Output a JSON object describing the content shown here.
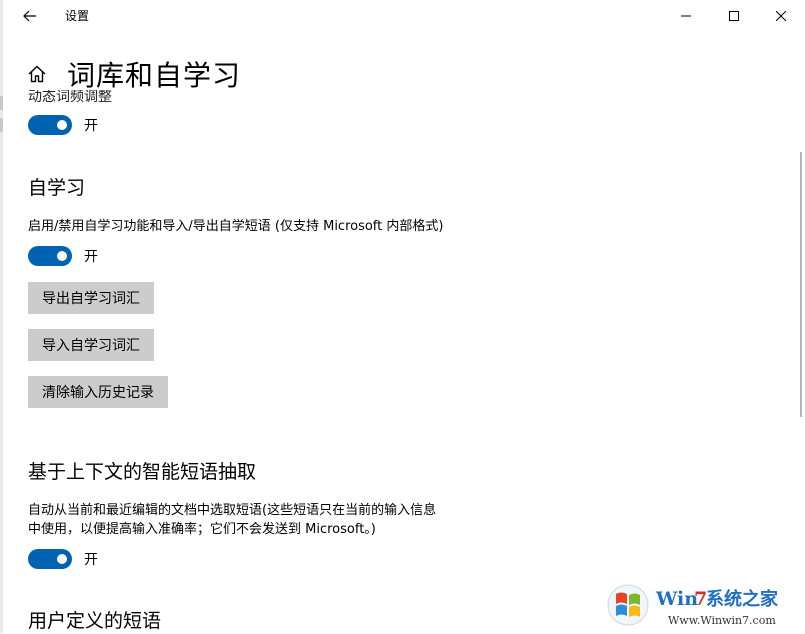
{
  "window": {
    "title": "设置",
    "back_icon": "arrow-left-icon",
    "controls": [
      "minimize-icon",
      "maximize-icon",
      "close-icon"
    ]
  },
  "header": {
    "home_icon": "home-icon",
    "title": "词库和自学习"
  },
  "top_section": {
    "label_partial": "动态词频调整",
    "toggle_state": "开",
    "toggle_on": true
  },
  "self_learning": {
    "title": "自学习",
    "description": "启用/禁用自学习功能和导入/导出自学短语 (仅支持 Microsoft 内部格式)",
    "toggle_state": "开",
    "toggle_on": true,
    "buttons": {
      "export": "导出自学习词汇",
      "import": "导入自学习词汇",
      "clear": "清除输入历史记录"
    }
  },
  "smart_phrases": {
    "title": "基于上下文的智能短语抽取",
    "description_line1": "自动从当前和最近编辑的文档中选取短语(这些短语只在当前的输入信息",
    "description_line2": "中使用，以便提高输入准确率；它们不会发送到 Microsoft。)",
    "toggle_state": "开",
    "toggle_on": true
  },
  "user_phrases": {
    "title": "用户定义的短语"
  },
  "watermark": {
    "brand": "Win7系统之家",
    "url": "Www.Winwin7.com"
  },
  "colors": {
    "accent": "#0063b1",
    "button_bg": "#cccccc"
  }
}
